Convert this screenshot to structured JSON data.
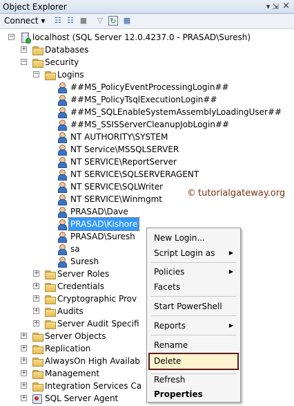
{
  "panel": {
    "title": "Object Explorer",
    "pin_icon": "pin-icon",
    "close_icon": "close-icon",
    "close_glyph": "×"
  },
  "toolbar": {
    "connect_label": "Connect ▾",
    "icons": [
      "connect-icon",
      "disconnect-icon",
      "stop-icon",
      "filter-icon",
      "refresh-icon",
      "activity-monitor-icon"
    ]
  },
  "tree": {
    "server": "localhost (SQL Server 12.0.4237.0 - PRASAD\\Suresh)",
    "databases": "Databases",
    "security": "Security",
    "logins_folder": "Logins",
    "logins": [
      "##MS_PolicyEventProcessingLogin##",
      "##MS_PolicyTsqlExecutionLogin##",
      "##MS_SQLEnableSystemAssemblyLoadingUser##",
      "##MS_SSISServerCleanupJobLogin##",
      "NT AUTHORITY\\SYSTEM",
      "NT Service\\MSSQLSERVER",
      "NT SERVICE\\ReportServer",
      "NT SERVICE\\SQLSERVERAGENT",
      "NT SERVICE\\SQLWriter",
      "NT SERVICE\\Winmgmt",
      "PRASAD\\Dave",
      "PRASAD\\Kishore",
      "PRASAD\\Suresh",
      "sa",
      "Suresh"
    ],
    "selected_login": "PRASAD\\Kishore",
    "security_children": [
      "Server Roles",
      "Credentials",
      "Cryptographic Prov",
      "Audits",
      "Server Audit Specifi"
    ],
    "top_level": [
      "Server Objects",
      "Replication",
      "AlwaysOn High Availab",
      "Management",
      "Integration Services Ca"
    ],
    "agent": "SQL Server Agent"
  },
  "watermark": {
    "mark": "©",
    "text": "tutorialgateway.org"
  },
  "context_menu": {
    "new_login": "New Login...",
    "script_login_as": "Script Login as",
    "policies": "Policies",
    "facets": "Facets",
    "start_powershell": "Start PowerShell",
    "reports": "Reports",
    "rename": "Rename",
    "delete": "Delete",
    "refresh": "Refresh",
    "properties": "Properties",
    "submenu_arrow": "▶"
  },
  "colors": {
    "selection": "#3399ff",
    "highlight_border": "#5a1a1a",
    "highlight_fill": "#fdf4cf"
  }
}
